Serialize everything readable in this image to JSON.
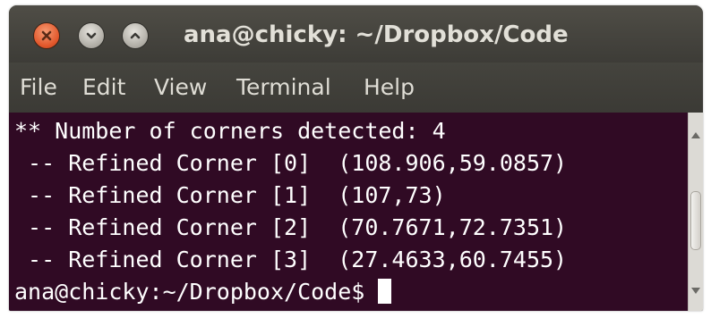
{
  "window": {
    "title": "ana@chicky: ~/Dropbox/Code",
    "buttons": {
      "close_icon": "close-icon",
      "minimize_icon": "minimize-icon",
      "maximize_icon": "maximize-icon"
    }
  },
  "menu": {
    "items": [
      "File",
      "Edit",
      "View",
      "Terminal",
      "Help"
    ]
  },
  "terminal": {
    "lines": [
      "** Number of corners detected: 4",
      " -- Refined Corner [0]  (108.906,59.0857)",
      " -- Refined Corner [1]  (107,73)",
      " -- Refined Corner [2]  (70.7671,72.7351)",
      " -- Refined Corner [3]  (27.4633,60.7455)"
    ],
    "prompt": "ana@chicky:~/Dropbox/Code$ "
  },
  "colors": {
    "terminal_background": "#300a24",
    "terminal_text": "#ffffff",
    "titlebar": "#3d3c37",
    "close_button": "#e2572b"
  }
}
